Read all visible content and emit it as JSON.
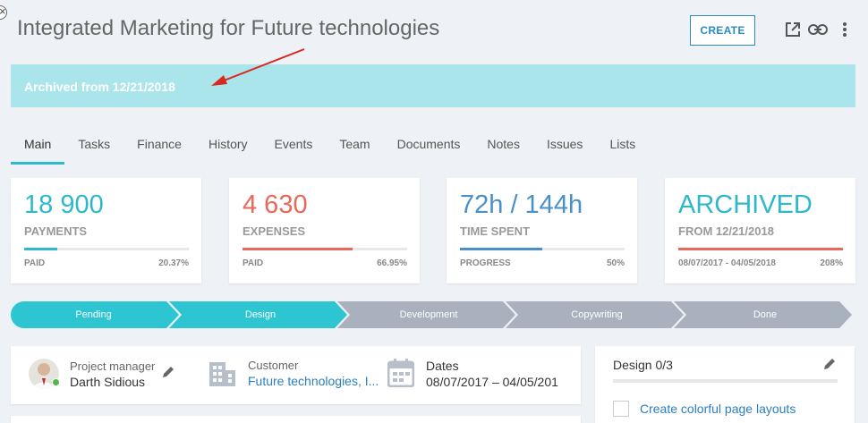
{
  "header": {
    "title": "Integrated Marketing for Future technologies",
    "create_label": "CREATE",
    "icons": [
      "external-link-icon",
      "link-icon",
      "more-vertical-icon"
    ]
  },
  "banner": {
    "text": "Archived from 12/21/2018",
    "color": "#abe5ec"
  },
  "tabs": [
    {
      "label": "Main",
      "active": true
    },
    {
      "label": "Tasks"
    },
    {
      "label": "Finance"
    },
    {
      "label": "History"
    },
    {
      "label": "Events"
    },
    {
      "label": "Team"
    },
    {
      "label": "Documents"
    },
    {
      "label": "Notes"
    },
    {
      "label": "Issues"
    },
    {
      "label": "Lists"
    }
  ],
  "cards": [
    {
      "value": "18 900",
      "label": "PAYMENTS",
      "foot_left": "PAID",
      "foot_right": "20.37%",
      "progress": 0.2037,
      "color": "#2eb8c9"
    },
    {
      "value": "4 630",
      "label": "EXPENSES",
      "foot_left": "PAID",
      "foot_right": "66.95%",
      "progress": 0.6695,
      "color": "#e8685a"
    },
    {
      "value": "72h / 144h",
      "label": "TIME SPENT",
      "foot_left": "PROGRESS",
      "foot_right": "50%",
      "progress": 0.5,
      "color": "#4a90c8"
    },
    {
      "value": "ARCHIVED",
      "label": "FROM 12/21/2018",
      "foot_left": "08/07/2017 - 04/05/2018",
      "foot_right": "208%",
      "progress": 1.0,
      "color": "#e8685a",
      "value_color": "#2eb8c9"
    }
  ],
  "pipeline": {
    "stages": [
      {
        "label": "Pending",
        "done": true
      },
      {
        "label": "Design",
        "done": true
      },
      {
        "label": "Development",
        "done": false
      },
      {
        "label": "Copywriting",
        "done": false
      },
      {
        "label": "Done",
        "done": false
      }
    ],
    "active_color": "#2ec5d3",
    "inactive_color": "#a9b1bf"
  },
  "info": {
    "pm_label": "Project manager",
    "pm_name": "Darth Sidious",
    "customer_label": "Customer",
    "customer_value": "Future technologies, I...",
    "dates_label": "Dates",
    "dates_value": "08/07/2017 – 04/05/201"
  },
  "checklist": {
    "title": "Design 0/3",
    "items": [
      "Create colorful page layouts"
    ]
  }
}
